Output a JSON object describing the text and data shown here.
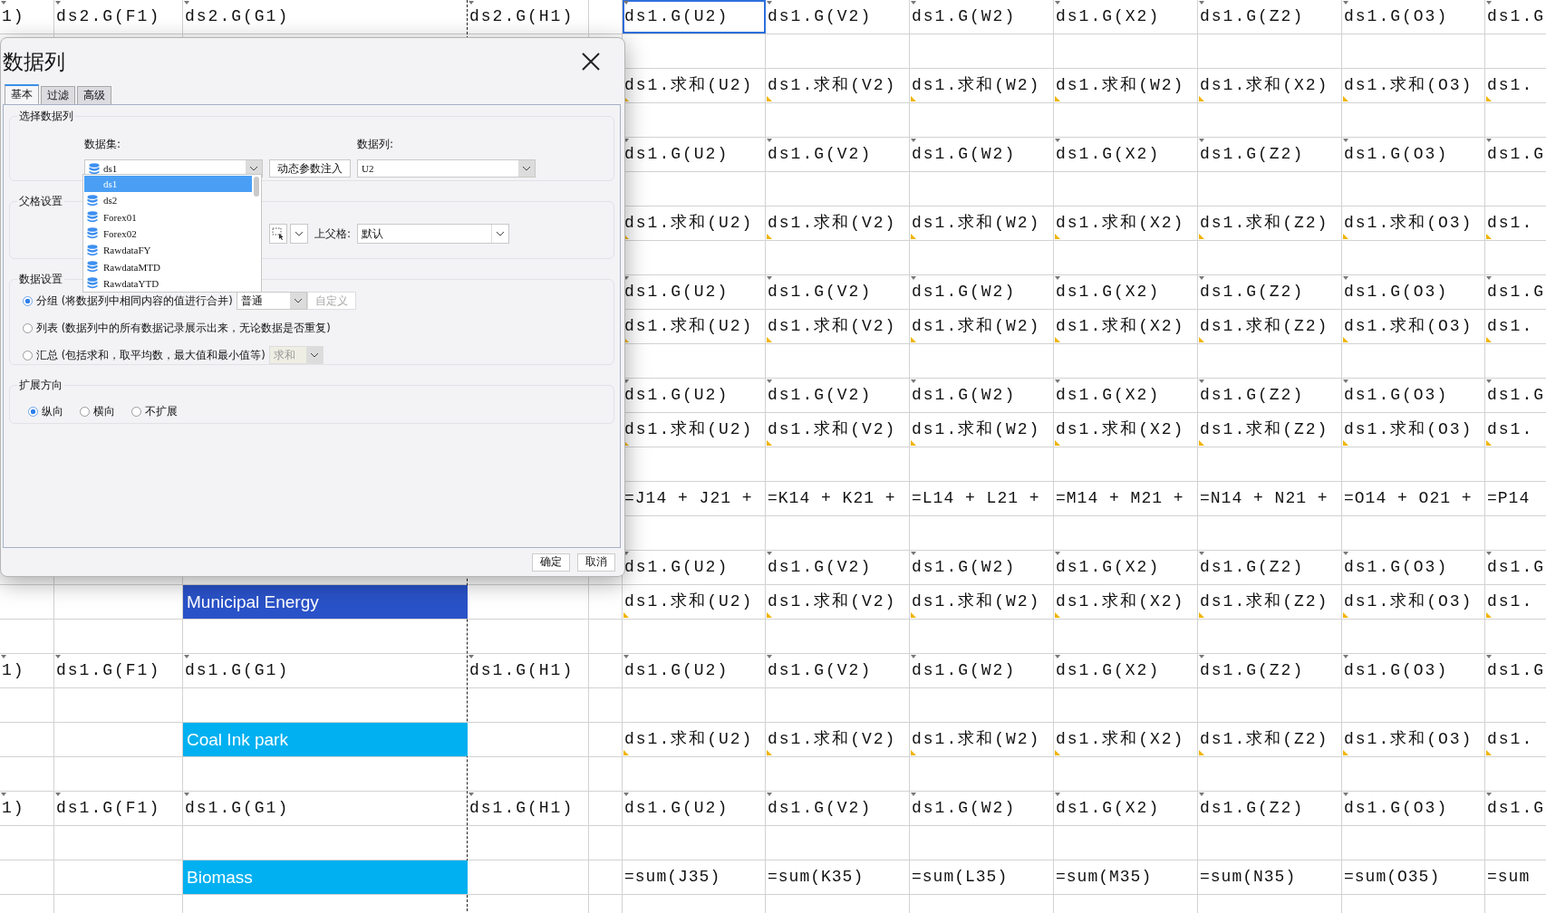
{
  "sheet": {
    "rows": [
      {
        "cells": [
          {
            "text": "1)",
            "kind": "group",
            "selected": false
          },
          {
            "text": "ds2.G(F1)",
            "kind": "group",
            "selected": false
          },
          {
            "text": "ds2.G(G1)",
            "kind": "group",
            "selected": false
          },
          {
            "text": "ds2.G(H1)",
            "kind": "group",
            "selected": false
          },
          null,
          {
            "text": "ds1.G(U2)",
            "kind": "group",
            "selected": true
          },
          {
            "text": "ds1.G(V2)",
            "kind": "group",
            "selected": false
          },
          {
            "text": "ds1.G(W2)",
            "kind": "group",
            "selected": false
          },
          {
            "text": "ds1.G(X2)",
            "kind": "group",
            "selected": false
          },
          {
            "text": "ds1.G(Z2)",
            "kind": "group",
            "selected": false
          },
          {
            "text": "ds1.G(O3)",
            "kind": "group",
            "selected": false
          },
          {
            "text": "ds1.G",
            "kind": "group",
            "selected": false
          }
        ]
      },
      {},
      {
        "cells": [
          null,
          null,
          null,
          null,
          null,
          {
            "text": "ds1.求和(U2)",
            "kind": "summary",
            "selected": false
          },
          {
            "text": "ds1.求和(V2)",
            "kind": "summary",
            "selected": false
          },
          {
            "text": "ds1.求和(W2)",
            "kind": "summary",
            "selected": false
          },
          {
            "text": "ds1.求和(W2)",
            "kind": "summary",
            "selected": false
          },
          {
            "text": "ds1.求和(X2)",
            "kind": "summary",
            "selected": false
          },
          {
            "text": "ds1.求和(O3)",
            "kind": "summary",
            "selected": false
          },
          {
            "text": "ds1.",
            "kind": "summary",
            "selected": false
          }
        ]
      },
      {},
      {
        "cells": [
          null,
          null,
          null,
          null,
          null,
          {
            "text": "ds1.G(U2)",
            "kind": "group",
            "selected": false
          },
          {
            "text": "ds1.G(V2)",
            "kind": "group",
            "selected": false
          },
          {
            "text": "ds1.G(W2)",
            "kind": "group",
            "selected": false
          },
          {
            "text": "ds1.G(X2)",
            "kind": "group",
            "selected": false
          },
          {
            "text": "ds1.G(Z2)",
            "kind": "group",
            "selected": false
          },
          {
            "text": "ds1.G(O3)",
            "kind": "group",
            "selected": false
          },
          {
            "text": "ds1.G",
            "kind": "group",
            "selected": false
          }
        ]
      },
      {},
      {
        "cells": [
          null,
          null,
          null,
          null,
          null,
          {
            "text": "ds1.求和(U2)",
            "kind": "summary",
            "selected": false
          },
          {
            "text": "ds1.求和(V2)",
            "kind": "summary",
            "selected": false
          },
          {
            "text": "ds1.求和(W2)",
            "kind": "summary",
            "selected": false
          },
          {
            "text": "ds1.求和(X2)",
            "kind": "summary",
            "selected": false
          },
          {
            "text": "ds1.求和(Z2)",
            "kind": "summary",
            "selected": false
          },
          {
            "text": "ds1.求和(O3)",
            "kind": "summary",
            "selected": false
          },
          {
            "text": "ds1.",
            "kind": "summary",
            "selected": false
          }
        ]
      },
      {},
      {
        "cells": [
          null,
          null,
          null,
          null,
          null,
          {
            "text": "ds1.G(U2)",
            "kind": "group",
            "selected": false
          },
          {
            "text": "ds1.G(V2)",
            "kind": "group",
            "selected": false
          },
          {
            "text": "ds1.G(W2)",
            "kind": "group",
            "selected": false
          },
          {
            "text": "ds1.G(X2)",
            "kind": "group",
            "selected": false
          },
          {
            "text": "ds1.G(Z2)",
            "kind": "group",
            "selected": false
          },
          {
            "text": "ds1.G(O3)",
            "kind": "group",
            "selected": false
          },
          {
            "text": "ds1.G",
            "kind": "group",
            "selected": false
          }
        ]
      },
      {
        "cells": [
          null,
          null,
          null,
          null,
          null,
          {
            "text": "ds1.求和(U2)",
            "kind": "summary",
            "selected": false
          },
          {
            "text": "ds1.求和(V2)",
            "kind": "summary",
            "selected": false
          },
          {
            "text": "ds1.求和(W2)",
            "kind": "summary",
            "selected": false
          },
          {
            "text": "ds1.求和(X2)",
            "kind": "summary",
            "selected": false
          },
          {
            "text": "ds1.求和(Z2)",
            "kind": "summary",
            "selected": false
          },
          {
            "text": "ds1.求和(O3)",
            "kind": "summary",
            "selected": false
          },
          {
            "text": "ds1.",
            "kind": "summary",
            "selected": false
          }
        ]
      },
      {},
      {
        "cells": [
          null,
          null,
          null,
          null,
          null,
          {
            "text": "ds1.G(U2)",
            "kind": "group",
            "selected": false
          },
          {
            "text": "ds1.G(V2)",
            "kind": "group",
            "selected": false
          },
          {
            "text": "ds1.G(W2)",
            "kind": "group",
            "selected": false
          },
          {
            "text": "ds1.G(X2)",
            "kind": "group",
            "selected": false
          },
          {
            "text": "ds1.G(Z2)",
            "kind": "group",
            "selected": false
          },
          {
            "text": "ds1.G(O3)",
            "kind": "group",
            "selected": false
          },
          {
            "text": "ds1.G",
            "kind": "group",
            "selected": false
          }
        ]
      },
      {
        "cells": [
          null,
          null,
          null,
          null,
          null,
          {
            "text": "ds1.求和(U2)",
            "kind": "summary",
            "selected": false
          },
          {
            "text": "ds1.求和(V2)",
            "kind": "summary",
            "selected": false
          },
          {
            "text": "ds1.求和(W2)",
            "kind": "summary",
            "selected": false
          },
          {
            "text": "ds1.求和(X2)",
            "kind": "summary",
            "selected": false
          },
          {
            "text": "ds1.求和(Z2)",
            "kind": "summary",
            "selected": false
          },
          {
            "text": "ds1.求和(O3)",
            "kind": "summary",
            "selected": false
          },
          {
            "text": "ds1.",
            "kind": "summary",
            "selected": false
          }
        ]
      },
      {},
      {
        "cells": [
          null,
          null,
          null,
          null,
          null,
          {
            "text": "=J14 + J21 +",
            "kind": "formula",
            "selected": false
          },
          {
            "text": "=K14 + K21 +",
            "kind": "formula",
            "selected": false
          },
          {
            "text": "=L14 + L21 +",
            "kind": "formula",
            "selected": false
          },
          {
            "text": "=M14 + M21 +",
            "kind": "formula",
            "selected": false
          },
          {
            "text": "=N14 + N21 +",
            "kind": "formula",
            "selected": false
          },
          {
            "text": "=O14 + O21 +",
            "kind": "formula",
            "selected": false
          },
          {
            "text": "=P14",
            "kind": "formula",
            "selected": false
          }
        ]
      },
      {},
      {
        "cells": [
          null,
          null,
          null,
          null,
          null,
          {
            "text": "ds1.G(U2)",
            "kind": "group",
            "selected": false
          },
          {
            "text": "ds1.G(V2)",
            "kind": "group",
            "selected": false
          },
          {
            "text": "ds1.G(W2)",
            "kind": "group",
            "selected": false
          },
          {
            "text": "ds1.G(X2)",
            "kind": "group",
            "selected": false
          },
          {
            "text": "ds1.G(Z2)",
            "kind": "group",
            "selected": false
          },
          {
            "text": "ds1.G(O3)",
            "kind": "group",
            "selected": false
          },
          {
            "text": "ds1.G",
            "kind": "group",
            "selected": false
          }
        ]
      },
      {
        "cells": [
          null,
          null,
          {
            "text": "Municipal Energy",
            "kind": "label",
            "color": "#2a52c8",
            "selected": false
          },
          null,
          null,
          {
            "text": "ds1.求和(U2)",
            "kind": "summary",
            "selected": false
          },
          {
            "text": "ds1.求和(V2)",
            "kind": "summary",
            "selected": false
          },
          {
            "text": "ds1.求和(W2)",
            "kind": "summary",
            "selected": false
          },
          {
            "text": "ds1.求和(X2)",
            "kind": "summary",
            "selected": false
          },
          {
            "text": "ds1.求和(Z2)",
            "kind": "summary",
            "selected": false
          },
          {
            "text": "ds1.求和(O3)",
            "kind": "summary",
            "selected": false
          },
          {
            "text": "ds1.",
            "kind": "summary",
            "selected": false
          }
        ]
      },
      {},
      {
        "cells": [
          {
            "text": "1)",
            "kind": "group",
            "selected": false
          },
          {
            "text": "ds1.G(F1)",
            "kind": "group",
            "selected": false
          },
          {
            "text": "ds1.G(G1)",
            "kind": "group",
            "selected": false
          },
          {
            "text": "ds1.G(H1)",
            "kind": "group",
            "selected": false
          },
          null,
          {
            "text": "ds1.G(U2)",
            "kind": "group",
            "selected": false
          },
          {
            "text": "ds1.G(V2)",
            "kind": "group",
            "selected": false
          },
          {
            "text": "ds1.G(W2)",
            "kind": "group",
            "selected": false
          },
          {
            "text": "ds1.G(X2)",
            "kind": "group",
            "selected": false
          },
          {
            "text": "ds1.G(Z2)",
            "kind": "group",
            "selected": false
          },
          {
            "text": "ds1.G(O3)",
            "kind": "group",
            "selected": false
          },
          {
            "text": "ds1.G",
            "kind": "group",
            "selected": false
          }
        ]
      },
      {},
      {
        "cells": [
          null,
          null,
          {
            "text": "Coal Ink park",
            "kind": "label",
            "color": "#00b0f0",
            "selected": false
          },
          null,
          null,
          {
            "text": "ds1.求和(U2)",
            "kind": "summary",
            "selected": false
          },
          {
            "text": "ds1.求和(V2)",
            "kind": "summary",
            "selected": false
          },
          {
            "text": "ds1.求和(W2)",
            "kind": "summary",
            "selected": false
          },
          {
            "text": "ds1.求和(X2)",
            "kind": "summary",
            "selected": false
          },
          {
            "text": "ds1.求和(Z2)",
            "kind": "summary",
            "selected": false
          },
          {
            "text": "ds1.求和(O3)",
            "kind": "summary",
            "selected": false
          },
          {
            "text": "ds1.",
            "kind": "summary",
            "selected": false
          }
        ]
      },
      {},
      {
        "cells": [
          {
            "text": "1)",
            "kind": "group",
            "selected": false
          },
          {
            "text": "ds1.G(F1)",
            "kind": "group",
            "selected": false
          },
          {
            "text": "ds1.G(G1)",
            "kind": "group",
            "selected": false
          },
          {
            "text": "ds1.G(H1)",
            "kind": "group",
            "selected": false
          },
          null,
          {
            "text": "ds1.G(U2)",
            "kind": "group",
            "selected": false
          },
          {
            "text": "ds1.G(V2)",
            "kind": "group",
            "selected": false
          },
          {
            "text": "ds1.G(W2)",
            "kind": "group",
            "selected": false
          },
          {
            "text": "ds1.G(X2)",
            "kind": "group",
            "selected": false
          },
          {
            "text": "ds1.G(Z2)",
            "kind": "group",
            "selected": false
          },
          {
            "text": "ds1.G(O3)",
            "kind": "group",
            "selected": false
          },
          {
            "text": "ds1.G",
            "kind": "group",
            "selected": false
          }
        ]
      },
      {},
      {
        "cells": [
          null,
          null,
          {
            "text": "Biomass",
            "kind": "label",
            "color": "#00b0f0",
            "selected": false
          },
          null,
          null,
          {
            "text": "=sum(J35)",
            "kind": "formula",
            "selected": false
          },
          {
            "text": "=sum(K35)",
            "kind": "formula",
            "selected": false
          },
          {
            "text": "=sum(L35)",
            "kind": "formula",
            "selected": false
          },
          {
            "text": "=sum(M35)",
            "kind": "formula",
            "selected": false
          },
          {
            "text": "=sum(N35)",
            "kind": "formula",
            "selected": false
          },
          {
            "text": "=sum(O35)",
            "kind": "formula",
            "selected": false
          },
          {
            "text": "=sum",
            "kind": "formula",
            "selected": false
          }
        ]
      },
      {}
    ]
  },
  "dialog": {
    "title": "数据列",
    "tabs": [
      {
        "label": "基本",
        "selected": true
      },
      {
        "label": "过滤",
        "selected": false
      },
      {
        "label": "高级",
        "selected": false
      }
    ],
    "source_group": {
      "legend": "选择数据列",
      "dataset_label": "数据集:",
      "dataset_value": "ds1",
      "inject_button": "动态参数注入",
      "column_label": "数据列:",
      "column_value": "U2"
    },
    "dataset_list": [
      {
        "label": "ds1",
        "selected": true
      },
      {
        "label": "ds2",
        "selected": false
      },
      {
        "label": "Forex01",
        "selected": false
      },
      {
        "label": "Forex02",
        "selected": false
      },
      {
        "label": "RawdataFY",
        "selected": false
      },
      {
        "label": "RawdataMTD",
        "selected": false
      },
      {
        "label": "RawdataYTD",
        "selected": false
      }
    ],
    "parent_group": {
      "legend": "父格设置",
      "upper_parent_label": "上父格:",
      "upper_parent_value": "默认"
    },
    "data_group": {
      "legend": "数据设置",
      "options": [
        {
          "label": "分组 (将数据列中相同内容的值进行合并)",
          "selected": true,
          "select": {
            "value": "普通",
            "disabled": false
          },
          "button": {
            "label": "自定义",
            "disabled": true
          }
        },
        {
          "label": "列表 (数据列中的所有数据记录展示出来，无论数据是否重复)",
          "selected": false
        },
        {
          "label": "汇总 (包括求和，取平均数，最大值和最小值等)",
          "selected": false,
          "select": {
            "value": "求和",
            "disabled": true
          }
        }
      ]
    },
    "expand_group": {
      "legend": "扩展方向",
      "options": [
        {
          "label": "纵向",
          "selected": true
        },
        {
          "label": "横向",
          "selected": false
        },
        {
          "label": "不扩展",
          "selected": false
        }
      ]
    },
    "buttons": [
      "确定",
      "取消"
    ]
  }
}
